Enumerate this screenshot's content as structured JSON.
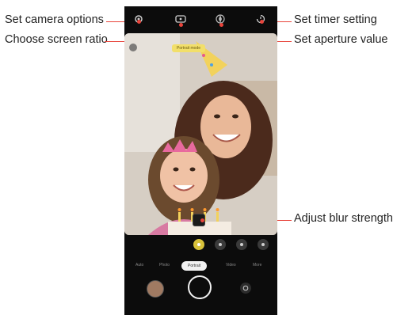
{
  "callouts": {
    "camera_options": "Set camera options",
    "screen_ratio": "Choose screen ratio",
    "timer": "Set timer setting",
    "aperture": "Set aperture value",
    "blur": "Adjust blur strength"
  },
  "camera": {
    "modes": [
      "Auto",
      "Photo",
      "Portrait",
      "Video",
      "More"
    ],
    "active_mode_index": 2,
    "hint_banner": "Portrait mode"
  },
  "colors": {
    "callout_line": "#e8453c",
    "active_effect": "#d8c23a"
  },
  "icons": {
    "settings": "gear-icon",
    "ratio": "aspect-ratio-icon",
    "aperture": "aperture-icon",
    "timer": "timer-icon",
    "flip": "switch-camera-icon",
    "gallery": "gallery-thumbnail",
    "shutter": "shutter-button"
  }
}
